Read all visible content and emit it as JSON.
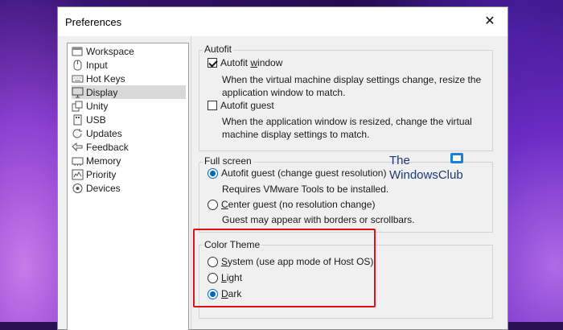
{
  "window": {
    "title": "Preferences",
    "close_glyph": "✕"
  },
  "nav": {
    "selected": "Display",
    "items": [
      {
        "label": "Workspace",
        "icon": "workspace-icon"
      },
      {
        "label": "Input",
        "icon": "mouse-icon"
      },
      {
        "label": "Hot Keys",
        "icon": "keyboard-icon"
      },
      {
        "label": "Display",
        "icon": "monitor-icon"
      },
      {
        "label": "Unity",
        "icon": "unity-icon"
      },
      {
        "label": "USB",
        "icon": "usb-icon"
      },
      {
        "label": "Updates",
        "icon": "refresh-icon"
      },
      {
        "label": "Feedback",
        "icon": "feedback-icon"
      },
      {
        "label": "Memory",
        "icon": "memory-icon"
      },
      {
        "label": "Priority",
        "icon": "priority-icon"
      },
      {
        "label": "Devices",
        "icon": "devices-icon"
      }
    ]
  },
  "autofit": {
    "group_label": "Autofit",
    "window_option": {
      "prefix": "Autofit ",
      "accel": "w",
      "rest": "indow",
      "checked": true
    },
    "window_desc": "When the virtual machine display settings change, resize the application window to match.",
    "guest_option": {
      "prefix": "Autofit ",
      "accel": "g",
      "rest": "uest",
      "checked": false
    },
    "guest_desc": "When the application window is resized, change the virtual machine display settings to match."
  },
  "fullscreen": {
    "group_label": "Full screen",
    "autofit_guest": {
      "prefix": "Autofit ",
      "accel": "g",
      "rest": "uest (change guest resolution)",
      "selected": true
    },
    "autofit_guest_desc": "Requires VMware Tools to be installed.",
    "center_guest": {
      "prefix": "",
      "accel": "C",
      "rest": "enter guest (no resolution change)",
      "selected": false
    },
    "center_guest_desc": "Guest may appear with borders or scrollbars."
  },
  "color_theme": {
    "group_label": "Color Theme",
    "system": {
      "prefix": "",
      "accel": "S",
      "rest": "ystem (use app mode of Host OS)",
      "selected": false
    },
    "light": {
      "prefix": "",
      "accel": "L",
      "rest": "ight",
      "selected": false
    },
    "dark": {
      "prefix": "",
      "accel": "D",
      "rest": "ark",
      "selected": true
    }
  },
  "watermark": {
    "line1": "The",
    "line2": "WindowsClub"
  },
  "colors": {
    "highlight": "#e0111b",
    "accent": "#0067c0",
    "watermark": "#1c3a7a"
  }
}
